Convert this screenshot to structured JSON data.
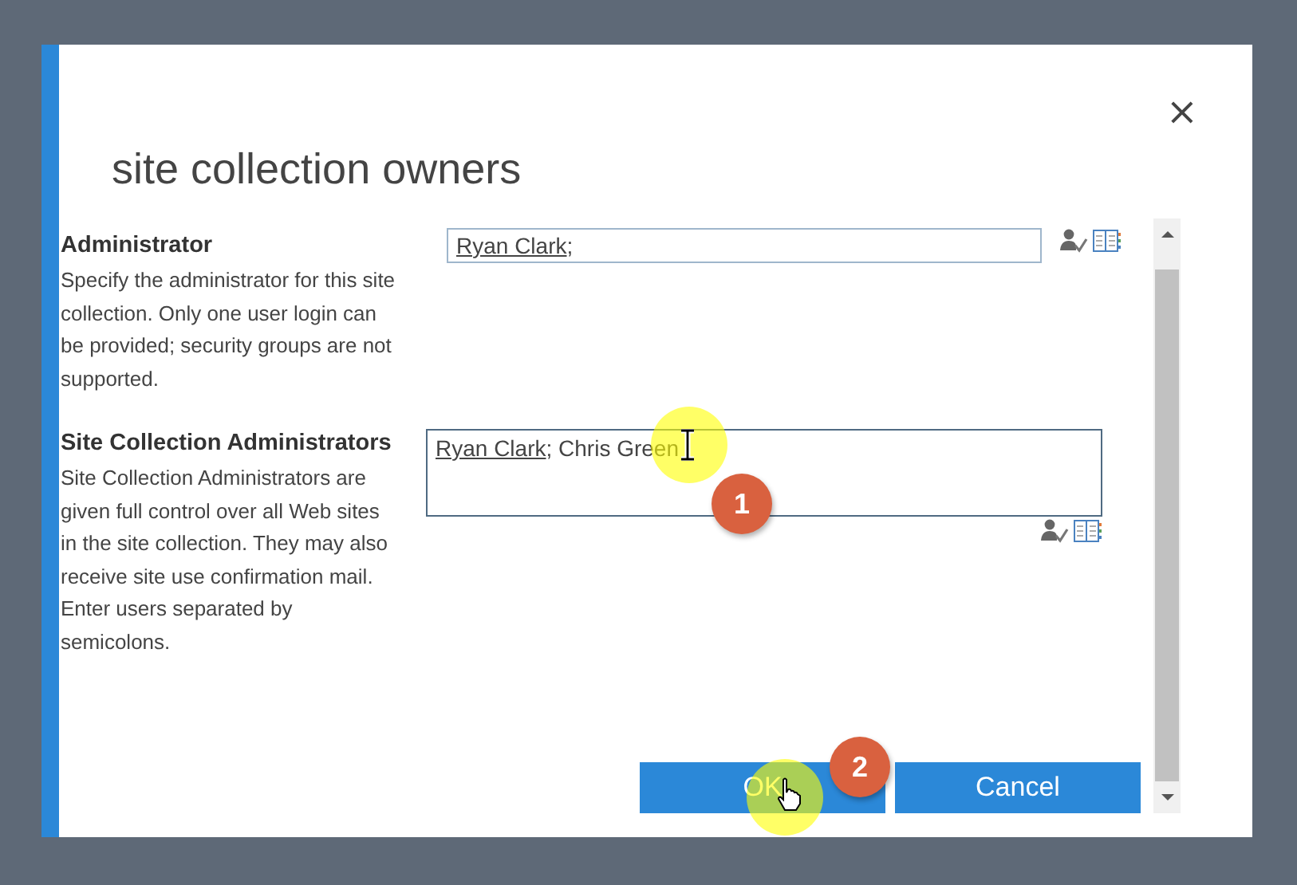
{
  "dialog": {
    "title": "site collection owners",
    "close": "×"
  },
  "sections": [
    {
      "label": "Administrator",
      "description": "Specify the administrator for this site collection. Only one user login can be provided; security groups are not supported.",
      "multiline": false,
      "entries": [
        {
          "text": "Ryan Clark",
          "resolved": true
        },
        {
          "text": ";",
          "resolved": false
        }
      ]
    },
    {
      "label": "Site Collection Administrators",
      "description": "Site Collection Administrators are given full control over all Web sites in the site collection. They may also receive site use confirmation mail. Enter users separated by semicolons.",
      "multiline": true,
      "entries": [
        {
          "text": "Ryan Clark",
          "resolved": true
        },
        {
          "text": "; Chris Green",
          "resolved": false
        }
      ]
    }
  ],
  "buttons": [
    {
      "label": "OK"
    },
    {
      "label": "Cancel"
    }
  ],
  "annotations": [
    {
      "number": "1",
      "kind": "text-cursor"
    },
    {
      "number": "2",
      "kind": "hand-cursor"
    }
  ]
}
